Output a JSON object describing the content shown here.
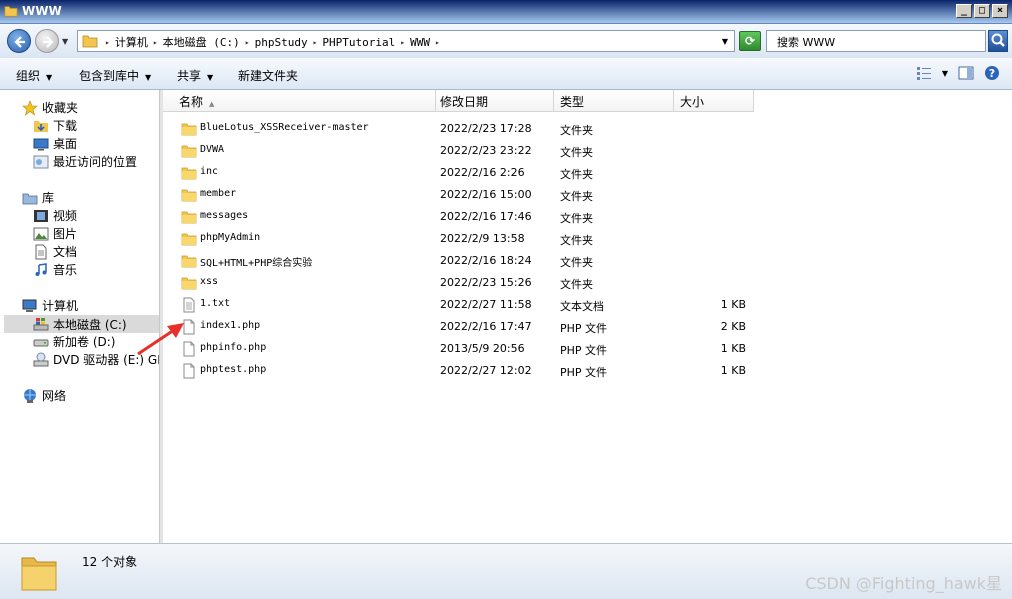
{
  "window": {
    "title": "WWW",
    "buttons": [
      "_",
      "□",
      "×"
    ]
  },
  "addressbar": {
    "breadcrumbs": [
      "计算机",
      "本地磁盘 (C:)",
      "phpStudy",
      "PHPTutorial",
      "WWW"
    ],
    "search_placeholder": "搜索 WWW"
  },
  "toolbar": {
    "organize": "组织",
    "include_in_library": "包含到库中",
    "share": "共享",
    "new_folder": "新建文件夹"
  },
  "sidebar": {
    "favorites": {
      "label": "收藏夹",
      "items": [
        "下载",
        "桌面",
        "最近访问的位置"
      ]
    },
    "libraries": {
      "label": "库",
      "items": [
        "视频",
        "图片",
        "文档",
        "音乐"
      ]
    },
    "computer": {
      "label": "计算机",
      "items": [
        "本地磁盘 (C:)",
        "新加卷 (D:)",
        "DVD 驱动器 (E:) GF"
      ]
    },
    "network": {
      "label": "网络"
    }
  },
  "columns": {
    "name": "名称",
    "modified": "修改日期",
    "type": "类型",
    "size": "大小"
  },
  "files": [
    {
      "name": "BlueLotus_XSSReceiver-master",
      "date": "2022/2/23 17:28",
      "type": "文件夹",
      "size": "",
      "kind": "folder"
    },
    {
      "name": "DVWA",
      "date": "2022/2/23 23:22",
      "type": "文件夹",
      "size": "",
      "kind": "folder"
    },
    {
      "name": "inc",
      "date": "2022/2/16 2:26",
      "type": "文件夹",
      "size": "",
      "kind": "folder"
    },
    {
      "name": "member",
      "date": "2022/2/16 15:00",
      "type": "文件夹",
      "size": "",
      "kind": "folder"
    },
    {
      "name": "messages",
      "date": "2022/2/16 17:46",
      "type": "文件夹",
      "size": "",
      "kind": "folder"
    },
    {
      "name": "phpMyAdmin",
      "date": "2022/2/9 13:58",
      "type": "文件夹",
      "size": "",
      "kind": "folder"
    },
    {
      "name": "SQL+HTML+PHP综合实验",
      "date": "2022/2/16 18:24",
      "type": "文件夹",
      "size": "",
      "kind": "folder"
    },
    {
      "name": "xss",
      "date": "2022/2/23 15:26",
      "type": "文件夹",
      "size": "",
      "kind": "folder"
    },
    {
      "name": "1.txt",
      "date": "2022/2/27 11:58",
      "type": "文本文档",
      "size": "1 KB",
      "kind": "text"
    },
    {
      "name": "index1.php",
      "date": "2022/2/16 17:47",
      "type": "PHP 文件",
      "size": "2 KB",
      "kind": "file"
    },
    {
      "name": "phpinfo.php",
      "date": "2013/5/9 20:56",
      "type": "PHP 文件",
      "size": "1 KB",
      "kind": "file"
    },
    {
      "name": "phptest.php",
      "date": "2022/2/27 12:02",
      "type": "PHP 文件",
      "size": "1 KB",
      "kind": "file"
    }
  ],
  "status": {
    "count": "12 个对象"
  },
  "watermark": "CSDN @Fighting_hawk星",
  "colors": {
    "folder": "#e8b84a",
    "arrow": "#e8302a",
    "selection": "#dadada"
  }
}
